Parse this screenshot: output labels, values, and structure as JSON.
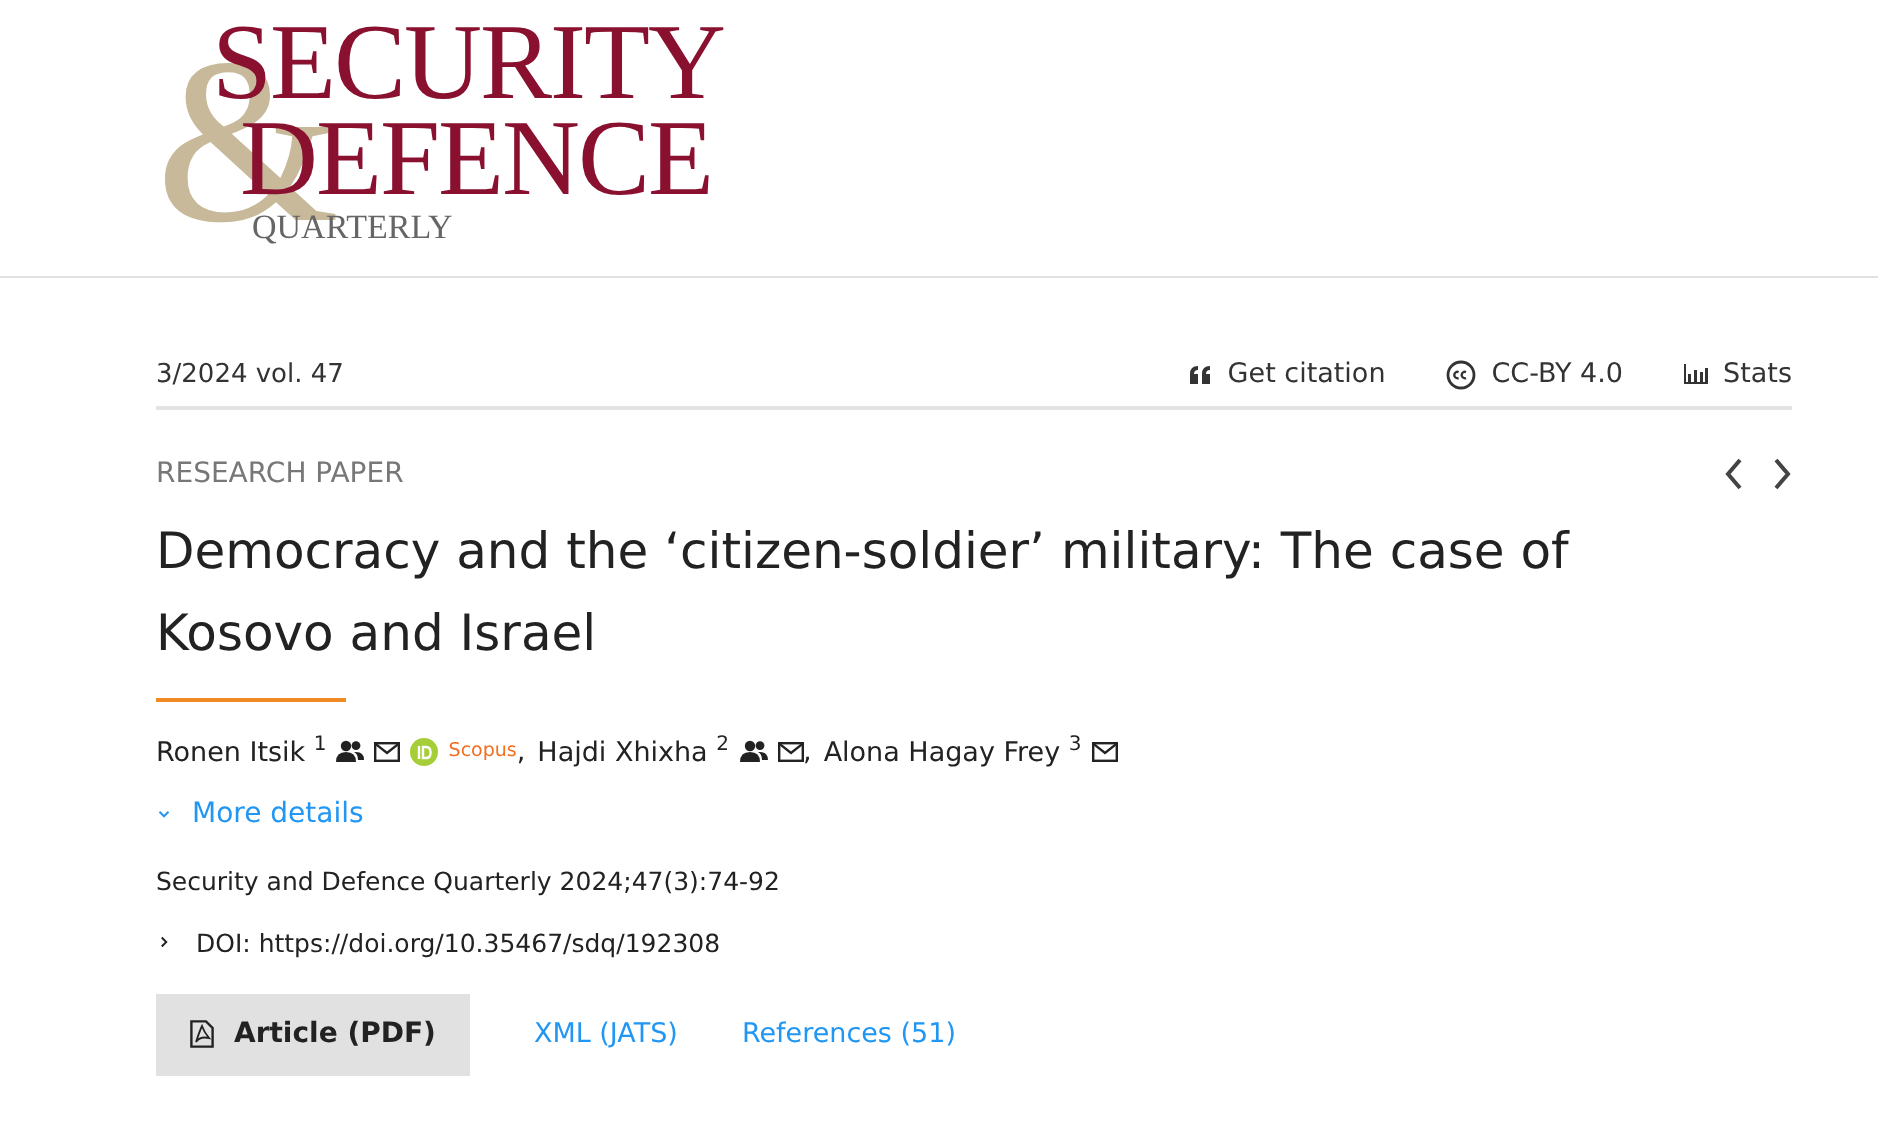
{
  "logo": {
    "line1": "SECURITY",
    "ampersand": "&",
    "line2": "DEFENCE",
    "line3": "QUARTERLY"
  },
  "issue": "3/2024 vol. 47",
  "actions": [
    {
      "kind": "quote",
      "label": "Get citation"
    },
    {
      "kind": "cc",
      "label": "CC-BY 4.0"
    },
    {
      "kind": "stats",
      "label": "Stats"
    }
  ],
  "nav": [
    {
      "kind": "prev"
    },
    {
      "kind": "next"
    }
  ],
  "category": "RESEARCH PAPER",
  "title": "Democracy and the ‘citizen-soldier’ military: The case of Kosovo and Israel",
  "authors": [
    {
      "name": "Ronen Itsik",
      "sup": "1",
      "badges": [
        {
          "kind": "people"
        },
        {
          "kind": "mail"
        },
        {
          "kind": "orcid"
        },
        {
          "kind": "scopus",
          "text": "Scopus"
        }
      ],
      "separator": ","
    },
    {
      "name": "Hajdi Xhixha",
      "sup": "2",
      "badges": [
        {
          "kind": "people"
        },
        {
          "kind": "mail"
        }
      ],
      "separator": ","
    },
    {
      "name": "Alona Hagay Frey",
      "sup": "3",
      "badges": [
        {
          "kind": "mail"
        }
      ]
    }
  ],
  "more_details": {
    "label": "More details",
    "expanded": false
  },
  "citation": "Security and Defence Quarterly 2024;47(3):74-92",
  "doi": {
    "label": "DOI: https://doi.org/10.35467/sdq/192308",
    "expanded": false
  },
  "buttons": [
    {
      "kind": "primary",
      "label": "Article (PDF)"
    },
    {
      "kind": "link",
      "label": "XML (JATS)"
    },
    {
      "kind": "link",
      "label": "References (51)"
    }
  ]
}
